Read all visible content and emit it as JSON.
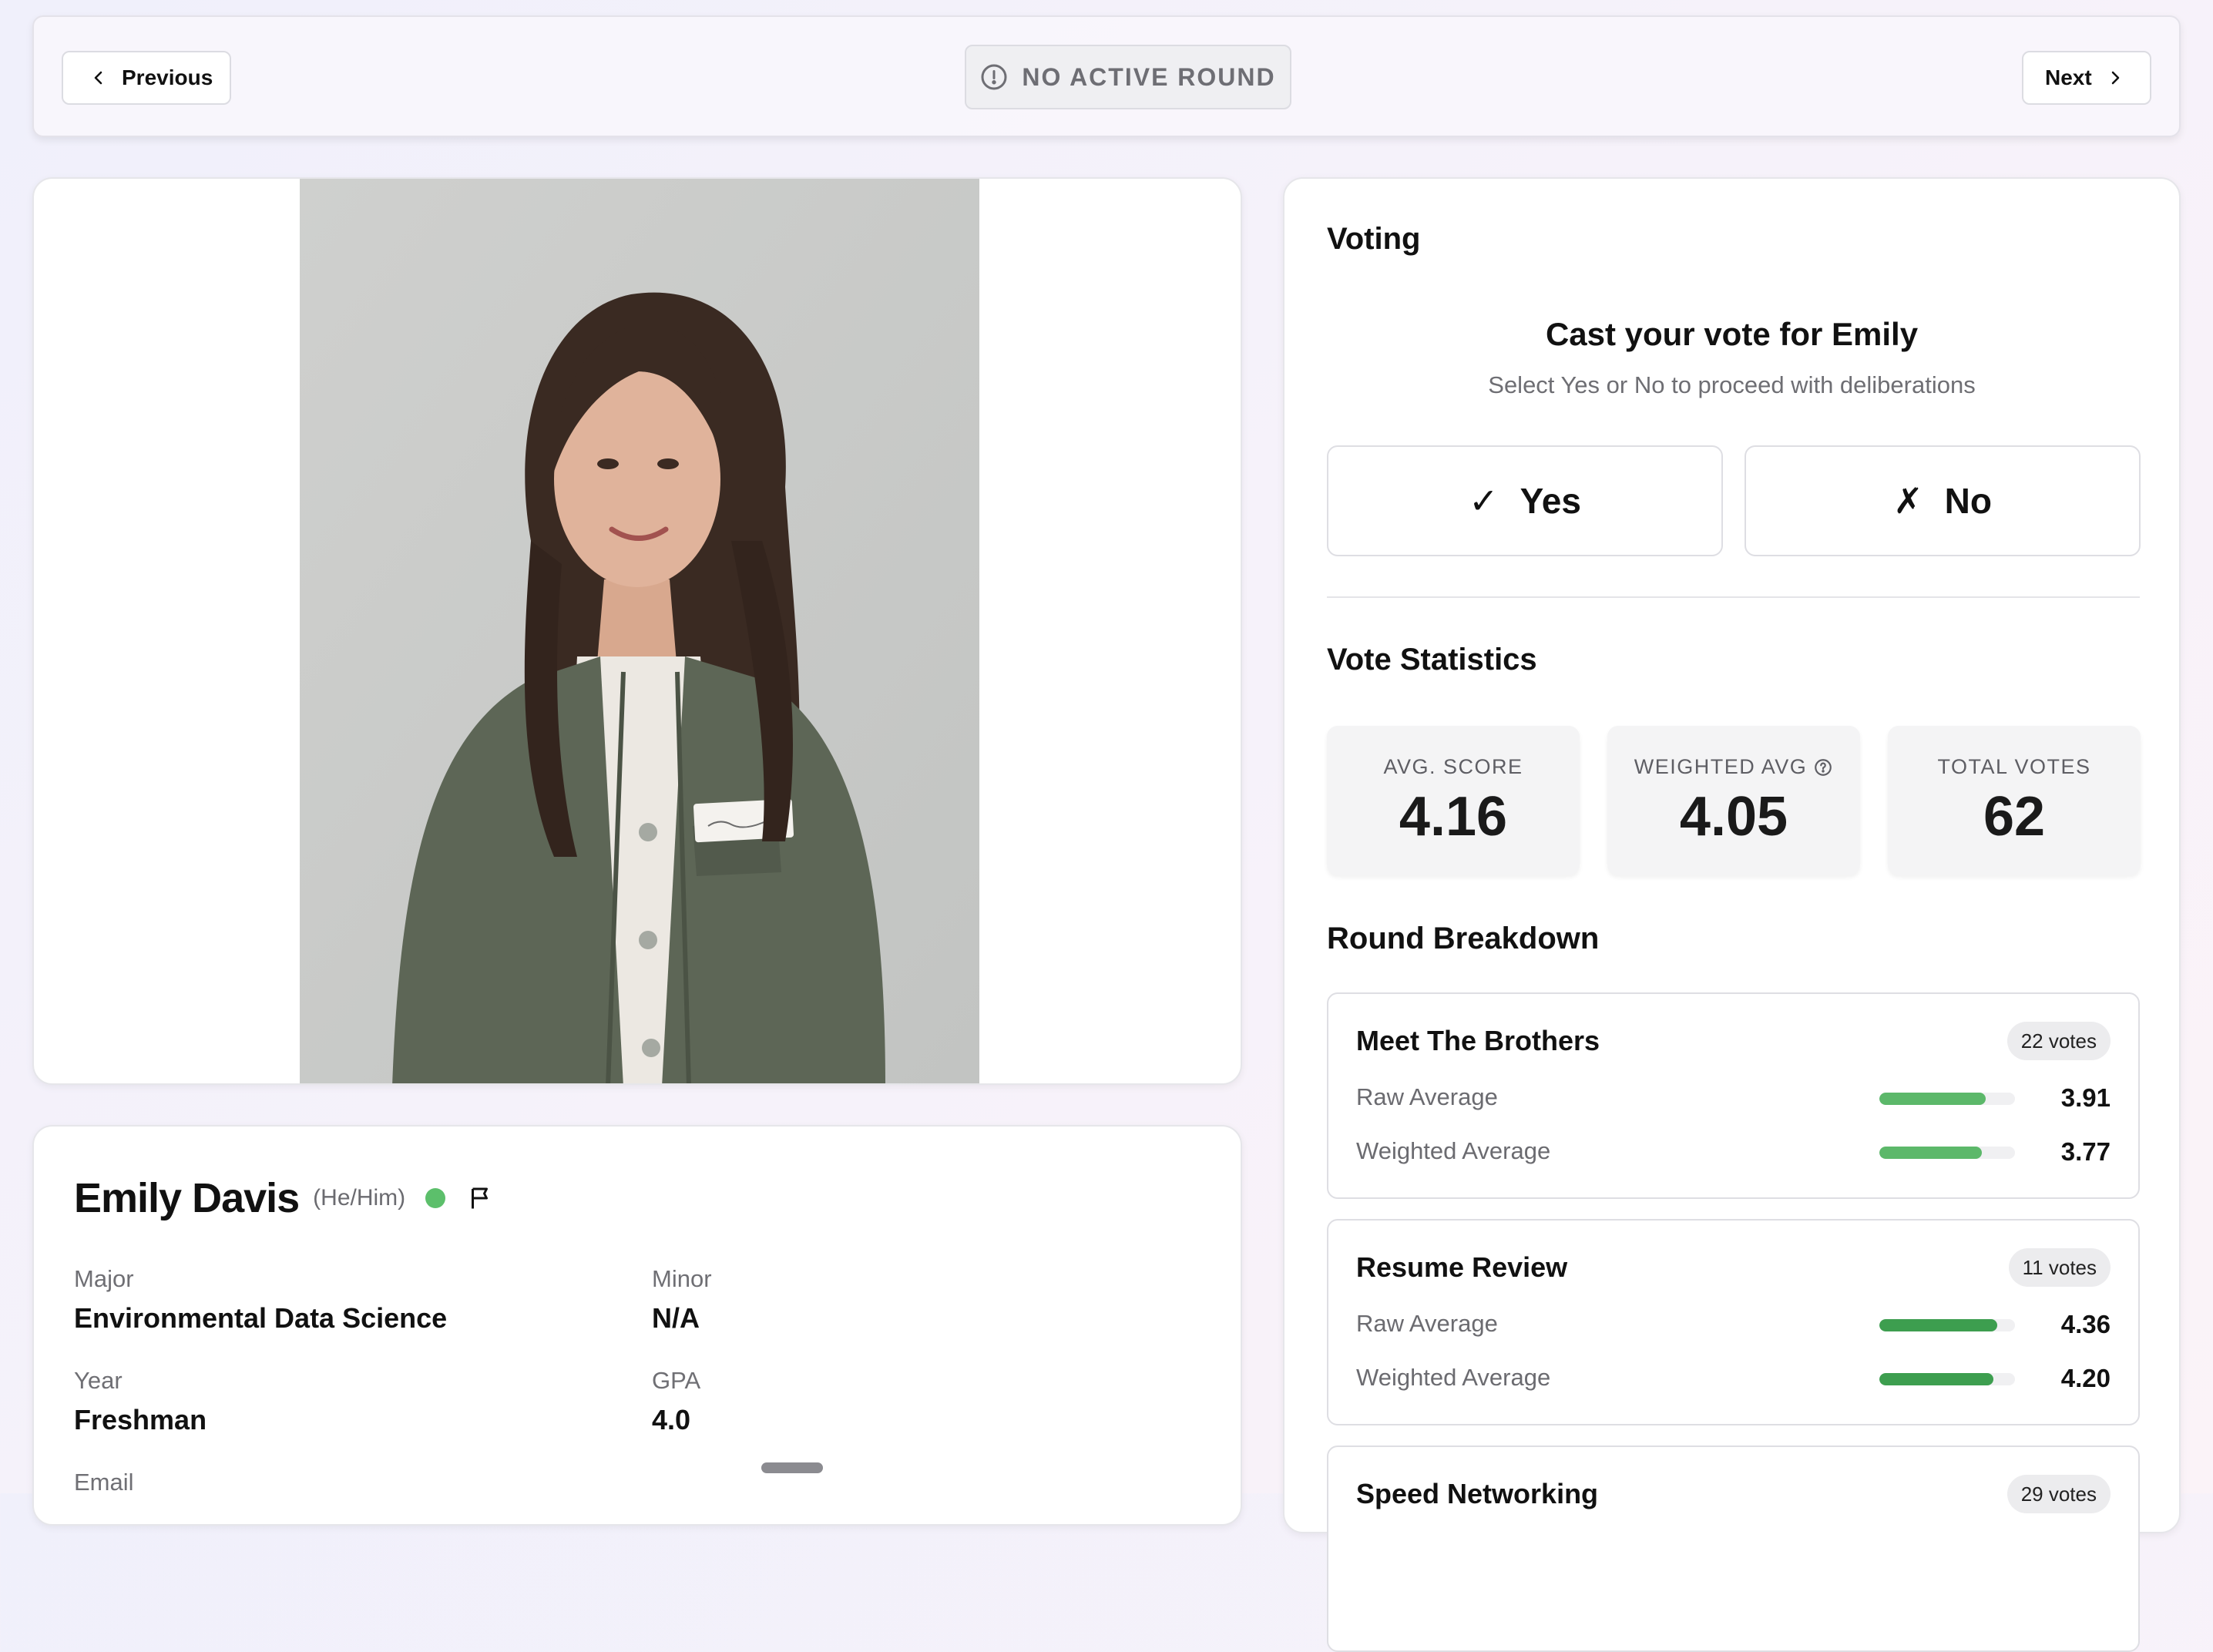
{
  "nav": {
    "previous_label": "Previous",
    "next_label": "Next",
    "round_status": "NO ACTIVE ROUND"
  },
  "profile": {
    "name": "Emily Davis",
    "pronouns": "(He/Him)",
    "status_color": "#5cbf6b",
    "fields": {
      "major_label": "Major",
      "major_value": "Environmental Data Science",
      "minor_label": "Minor",
      "minor_value": "N/A",
      "year_label": "Year",
      "year_value": "Freshman",
      "gpa_label": "GPA",
      "gpa_value": "4.0",
      "email_label": "Email"
    }
  },
  "voting": {
    "heading": "Voting",
    "title": "Cast your vote for Emily",
    "subtitle": "Select Yes or No to proceed with deliberations",
    "yes_glyph": "✓",
    "yes_label": "Yes",
    "no_glyph": "✗",
    "no_label": "No"
  },
  "stats": {
    "heading": "Vote Statistics",
    "avg_label": "AVG. SCORE",
    "avg_value": "4.16",
    "weighted_label": "WEIGHTED AVG",
    "weighted_value": "4.05",
    "total_label": "TOTAL VOTES",
    "total_value": "62"
  },
  "breakdown": {
    "heading": "Round Breakdown",
    "raw_label": "Raw Average",
    "weighted_label": "Weighted Average",
    "max_score": 5,
    "rounds": [
      {
        "name": "Meet The Brothers",
        "votes": "22 votes",
        "raw": "3.91",
        "weighted": "3.77",
        "bar_color": "#5cb86a"
      },
      {
        "name": "Resume Review",
        "votes": "11 votes",
        "raw": "4.36",
        "weighted": "4.20",
        "bar_color": "#3d9e4f"
      },
      {
        "name": "Speed Networking",
        "votes": "29 votes"
      }
    ]
  }
}
